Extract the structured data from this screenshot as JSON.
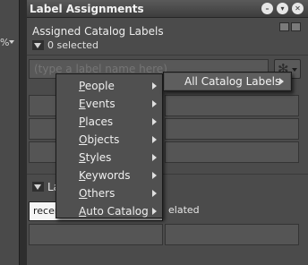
{
  "left_panel": {
    "fragment": "%"
  },
  "panel": {
    "title": "Label Assignments",
    "title_buttons": [
      "minimize-icon",
      "options-icon",
      "close-icon"
    ]
  },
  "assigned": {
    "section_title": "Assigned Catalog Labels",
    "selected_count": "0 selected"
  },
  "label_input": {
    "placeholder": "(type a label name here)"
  },
  "section2": {
    "label_fragment": "La"
  },
  "tabs": {
    "recent_fragment": "recen",
    "related_fragment": "elated"
  },
  "context_menu": {
    "items": [
      {
        "label": "People",
        "accel": "P",
        "rest": "eople"
      },
      {
        "label": "Events",
        "accel": "E",
        "rest": "vents"
      },
      {
        "label": "Places",
        "accel": "P",
        "rest": "laces"
      },
      {
        "label": "Objects",
        "accel": "O",
        "rest": "bjects"
      },
      {
        "label": "Styles",
        "accel": "S",
        "rest": "tyles"
      },
      {
        "label": "Keywords",
        "accel": "K",
        "rest": "eywords"
      },
      {
        "label": "Others",
        "accel": "O",
        "rest": "thers"
      },
      {
        "label": "Auto Catalog",
        "accel": "A",
        "rest": "uto Catalog"
      }
    ],
    "submenu": {
      "label": "All Catalog Labels"
    }
  }
}
